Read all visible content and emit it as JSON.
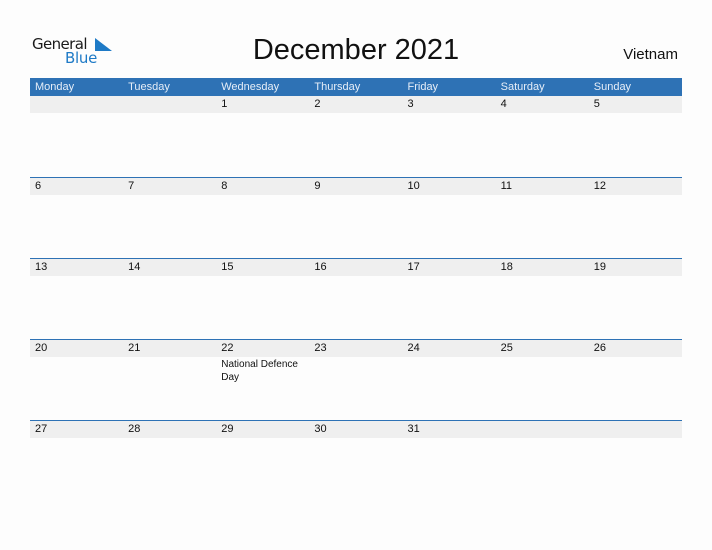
{
  "brand": {
    "logo_word1": "General",
    "logo_word2": "Blue",
    "accent_color": "#1e7ac6",
    "header_color": "#2e72b5"
  },
  "header": {
    "title": "December 2021",
    "country": "Vietnam"
  },
  "calendar": {
    "weekdays": [
      "Monday",
      "Tuesday",
      "Wednesday",
      "Thursday",
      "Friday",
      "Saturday",
      "Sunday"
    ],
    "weeks": [
      {
        "days": [
          "",
          "",
          "1",
          "2",
          "3",
          "4",
          "5"
        ],
        "events": [
          "",
          "",
          "",
          "",
          "",
          "",
          ""
        ]
      },
      {
        "days": [
          "6",
          "7",
          "8",
          "9",
          "10",
          "11",
          "12"
        ],
        "events": [
          "",
          "",
          "",
          "",
          "",
          "",
          ""
        ]
      },
      {
        "days": [
          "13",
          "14",
          "15",
          "16",
          "17",
          "18",
          "19"
        ],
        "events": [
          "",
          "",
          "",
          "",
          "",
          "",
          ""
        ]
      },
      {
        "days": [
          "20",
          "21",
          "22",
          "23",
          "24",
          "25",
          "26"
        ],
        "events": [
          "",
          "",
          "National Defence Day",
          "",
          "",
          "",
          ""
        ]
      },
      {
        "days": [
          "27",
          "28",
          "29",
          "30",
          "31",
          "",
          ""
        ],
        "events": [
          "",
          "",
          "",
          "",
          "",
          "",
          ""
        ]
      }
    ]
  }
}
